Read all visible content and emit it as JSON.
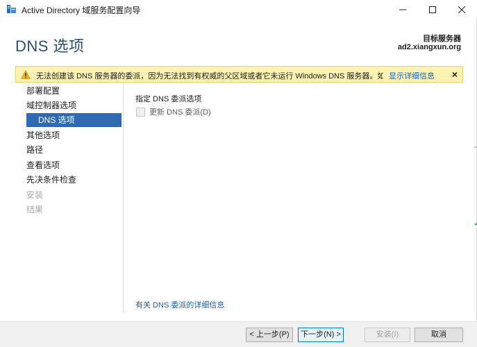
{
  "window": {
    "title": "Active Directory 域服务配置向导",
    "controls": {
      "minimize_icon": "minimize-icon",
      "maximize_icon": "maximize-icon",
      "close_icon": "close-icon"
    }
  },
  "header": {
    "page_title": "DNS 选项",
    "target_server_label": "目标服务器",
    "target_server_name": "ad2.xiangxun.org"
  },
  "warning": {
    "message": "无法创建该 DNS 服务器的委派，因为无法找到有权威的父区域或者它未运行 Windows DNS 服务器。如...",
    "details_link": "显示详细信息",
    "close_label": "×",
    "color": "#fcf3b3"
  },
  "nav": {
    "items": [
      {
        "label": "部署配置",
        "state": "normal"
      },
      {
        "label": "域控制器选项",
        "state": "normal"
      },
      {
        "label": "DNS 选项",
        "state": "active"
      },
      {
        "label": "其他选项",
        "state": "normal"
      },
      {
        "label": "路径",
        "state": "normal"
      },
      {
        "label": "查看选项",
        "state": "normal"
      },
      {
        "label": "先决条件检查",
        "state": "normal"
      },
      {
        "label": "安装",
        "state": "disabled"
      },
      {
        "label": "结果",
        "state": "disabled"
      }
    ],
    "active_color": "#2e69b3"
  },
  "content": {
    "heading": "指定 DNS 委派选项",
    "checkbox_label": "更新 DNS 委派(D)",
    "checkbox_checked": false,
    "info_link": "有关 DNS 委派的详细信息"
  },
  "footer": {
    "prev_label": "< 上一步(P)",
    "next_label": "下一步(N) >",
    "install_label": "安装(I)",
    "cancel_label": "取消"
  }
}
